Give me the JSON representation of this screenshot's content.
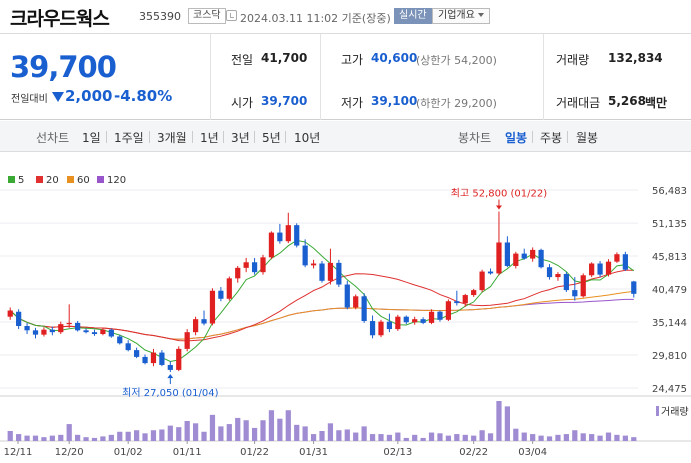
{
  "header": {
    "stock_name": "크라우드웍스",
    "stock_code": "355390",
    "market": "코스닥",
    "timestamp": "2024.03.11 11:02 기준(장중)",
    "realtime_label": "실시간",
    "company_overview_label": "기업개요"
  },
  "quote": {
    "price": "39,700",
    "prev_close_label": "전일대비",
    "change": "2,000",
    "change_pct": "-4.80%",
    "direction": "down",
    "prev_close": {
      "label": "전일",
      "value": "41,700"
    },
    "high": {
      "label": "고가",
      "value": "40,600",
      "sub": "(상한가 54,200)"
    },
    "volume": {
      "label": "거래량",
      "value": "132,834"
    },
    "open": {
      "label": "시가",
      "value": "39,700"
    },
    "low": {
      "label": "저가",
      "value": "39,100",
      "sub": "(하한가 29,200)"
    },
    "trade_value": {
      "label": "거래대금",
      "value": "5,268",
      "unit": "백만"
    }
  },
  "tabs": {
    "line_chart_label": "선차트",
    "line_periods": [
      "1일",
      "1주일",
      "3개월",
      "1년",
      "3년",
      "5년",
      "10년"
    ],
    "candle_chart_label": "봉차트",
    "candle_periods": [
      "일봉",
      "주봉",
      "월봉"
    ],
    "active": "일봉"
  },
  "colors": {
    "up": "#e02020",
    "down": "#1a5fd0",
    "ma5": "#3aaa35",
    "ma20": "#e03030",
    "ma60": "#e89020",
    "ma120": "#9955cc",
    "volume": "#a08cd2"
  },
  "chart_data": {
    "type": "candlestick",
    "legend": [
      "5",
      "20",
      "60",
      "120"
    ],
    "y_ticks": [
      "56,483",
      "51,135",
      "45,813",
      "40,479",
      "35,144",
      "29,810",
      "24,475"
    ],
    "x_ticks": [
      "12/11",
      "12/20",
      "01/02",
      "01/11",
      "01/22",
      "01/31",
      "02/13",
      "02/22",
      "03/04"
    ],
    "ylim": [
      24475,
      56483
    ],
    "high_annotation": "최고 52,800 (01/22)",
    "low_annotation": "최저 27,050 (01/04)",
    "volume_label": "거래량",
    "candles": [
      [
        36000,
        37500,
        35500,
        37000
      ],
      [
        36800,
        37200,
        34000,
        34500
      ],
      [
        34500,
        35000,
        33200,
        33800
      ],
      [
        33800,
        34200,
        32500,
        33100
      ],
      [
        33100,
        34300,
        32800,
        33900
      ],
      [
        33900,
        34400,
        33000,
        33500
      ],
      [
        33500,
        35200,
        33200,
        34800
      ],
      [
        34800,
        38000,
        34200,
        35000
      ],
      [
        35000,
        35300,
        33600,
        33800
      ],
      [
        33800,
        34100,
        33300,
        33500
      ],
      [
        33500,
        33900,
        32900,
        33200
      ],
      [
        33200,
        34200,
        33000,
        33900
      ],
      [
        33900,
        34100,
        32600,
        32800
      ],
      [
        32800,
        33100,
        31500,
        31700
      ],
      [
        31700,
        32200,
        30400,
        30600
      ],
      [
        30600,
        31000,
        29300,
        29500
      ],
      [
        29500,
        29900,
        28300,
        28500
      ],
      [
        28500,
        30800,
        28000,
        30200
      ],
      [
        30200,
        30600,
        28000,
        28200
      ],
      [
        28200,
        28800,
        27050,
        27400
      ],
      [
        27400,
        31200,
        27200,
        30800
      ],
      [
        30800,
        34000,
        30400,
        33500
      ],
      [
        33500,
        36000,
        33000,
        35600
      ],
      [
        35600,
        37000,
        34600,
        34900
      ],
      [
        34900,
        40600,
        34600,
        40200
      ],
      [
        40200,
        40800,
        38500,
        38900
      ],
      [
        38900,
        42500,
        38600,
        42200
      ],
      [
        42200,
        44200,
        41500,
        43900
      ],
      [
        43900,
        45500,
        43200,
        44800
      ],
      [
        44800,
        45500,
        42800,
        43200
      ],
      [
        43200,
        46000,
        42800,
        45600
      ],
      [
        45600,
        49800,
        45300,
        49600
      ],
      [
        49600,
        51000,
        47800,
        48200
      ],
      [
        48200,
        52800,
        47900,
        50800
      ],
      [
        50800,
        51100,
        47200,
        47500
      ],
      [
        47500,
        48500,
        44000,
        44300
      ],
      [
        44300,
        45200,
        43800,
        44600
      ],
      [
        44600,
        45000,
        41500,
        41800
      ],
      [
        41800,
        47000,
        41200,
        44700
      ],
      [
        44700,
        45200,
        40800,
        41200
      ],
      [
        41200,
        41800,
        37200,
        37500
      ],
      [
        37500,
        39600,
        37200,
        39300
      ],
      [
        39300,
        39800,
        35000,
        35300
      ],
      [
        35300,
        36200,
        32500,
        33000
      ],
      [
        33000,
        35500,
        32700,
        35200
      ],
      [
        35200,
        36500,
        33500,
        34000
      ],
      [
        34000,
        36300,
        33700,
        36000
      ],
      [
        36000,
        36200,
        34800,
        35100
      ],
      [
        35100,
        36000,
        34700,
        35600
      ],
      [
        35600,
        35900,
        34800,
        35000
      ],
      [
        35000,
        37200,
        34800,
        36800
      ],
      [
        36800,
        37000,
        35200,
        35500
      ],
      [
        35500,
        38800,
        35300,
        38500
      ],
      [
        38500,
        40200,
        37800,
        38200
      ],
      [
        38200,
        39700,
        37600,
        39500
      ],
      [
        39500,
        40500,
        39200,
        40300
      ],
      [
        40300,
        43600,
        40000,
        43300
      ],
      [
        43300,
        43800,
        42800,
        43000
      ],
      [
        43000,
        53000,
        42700,
        48000
      ],
      [
        48000,
        49000,
        44000,
        44200
      ],
      [
        44200,
        46500,
        43800,
        46200
      ],
      [
        46200,
        47000,
        45200,
        45400
      ],
      [
        45400,
        47200,
        44900,
        46800
      ],
      [
        46800,
        47000,
        43800,
        44000
      ],
      [
        44000,
        44500,
        42000,
        42400
      ],
      [
        42400,
        43200,
        41800,
        42900
      ],
      [
        42900,
        43200,
        40000,
        40300
      ],
      [
        40300,
        42400,
        38600,
        39300
      ],
      [
        39300,
        43000,
        39100,
        42700
      ],
      [
        42700,
        44800,
        42400,
        44600
      ],
      [
        44600,
        45000,
        42400,
        42800
      ],
      [
        42800,
        45300,
        42500,
        44900
      ],
      [
        44900,
        46400,
        44700,
        46100
      ],
      [
        46100,
        46500,
        43400,
        43600
      ],
      [
        41700,
        41800,
        39100,
        39700
      ]
    ],
    "volumes": [
      13,
      9,
      7,
      7,
      5,
      7,
      8,
      22,
      8,
      5,
      4,
      6,
      8,
      12,
      12,
      14,
      10,
      14,
      15,
      20,
      18,
      26,
      23,
      12,
      34,
      19,
      22,
      30,
      27,
      17,
      27,
      40,
      29,
      40,
      21,
      19,
      9,
      13,
      23,
      14,
      15,
      11,
      19,
      9,
      9,
      8,
      11,
      4,
      8,
      4,
      11,
      10,
      7,
      9,
      8,
      7,
      14,
      10,
      52,
      45,
      16,
      11,
      9,
      7,
      6,
      8,
      9,
      14,
      10,
      9,
      7,
      11,
      8,
      7,
      5
    ]
  }
}
